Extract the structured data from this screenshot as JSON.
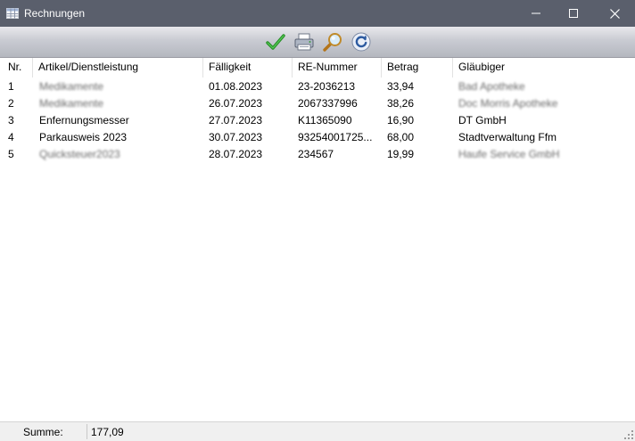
{
  "window": {
    "title": "Rechnungen"
  },
  "toolbar": {
    "icons": [
      "checkmark-icon",
      "printer-icon",
      "magnifier-icon",
      "refresh-icon"
    ]
  },
  "table": {
    "columns": [
      "Nr.",
      "Artikel/Dienstleistung",
      "Fälligkeit",
      "RE-Nummer",
      "Betrag",
      "Gläubiger"
    ],
    "rows": [
      {
        "nr": "1",
        "artikel": "Medikamente",
        "faelligkeit": "01.08.2023",
        "re_nummer": "23-2036213",
        "betrag": "33,94",
        "glaeubiger": "Bad Apotheke"
      },
      {
        "nr": "2",
        "artikel": "Medikamente",
        "faelligkeit": "26.07.2023",
        "re_nummer": "2067337996",
        "betrag": "38,26",
        "glaeubiger": "Doc Morris Apotheke"
      },
      {
        "nr": "3",
        "artikel": "Enfernungsmesser",
        "faelligkeit": "27.07.2023",
        "re_nummer": "K11365090",
        "betrag": "16,90",
        "glaeubiger": "DT GmbH"
      },
      {
        "nr": "4",
        "artikel": "Parkausweis 2023",
        "faelligkeit": "30.07.2023",
        "re_nummer": "93254001725...",
        "betrag": "68,00",
        "glaeubiger": "Stadtverwaltung Ffm"
      },
      {
        "nr": "5",
        "artikel": "Quicksteuer2023",
        "faelligkeit": "28.07.2023",
        "re_nummer": "234567",
        "betrag": "19,99",
        "glaeubiger": "Haufe Service GmbH"
      }
    ]
  },
  "status": {
    "sum_label": "Summe:",
    "sum_value": "177,09"
  },
  "colors": {
    "titlebar": "#5a5f6c",
    "accent_check": "#2a9a2a",
    "refresh_blue": "#2c5aa0"
  }
}
